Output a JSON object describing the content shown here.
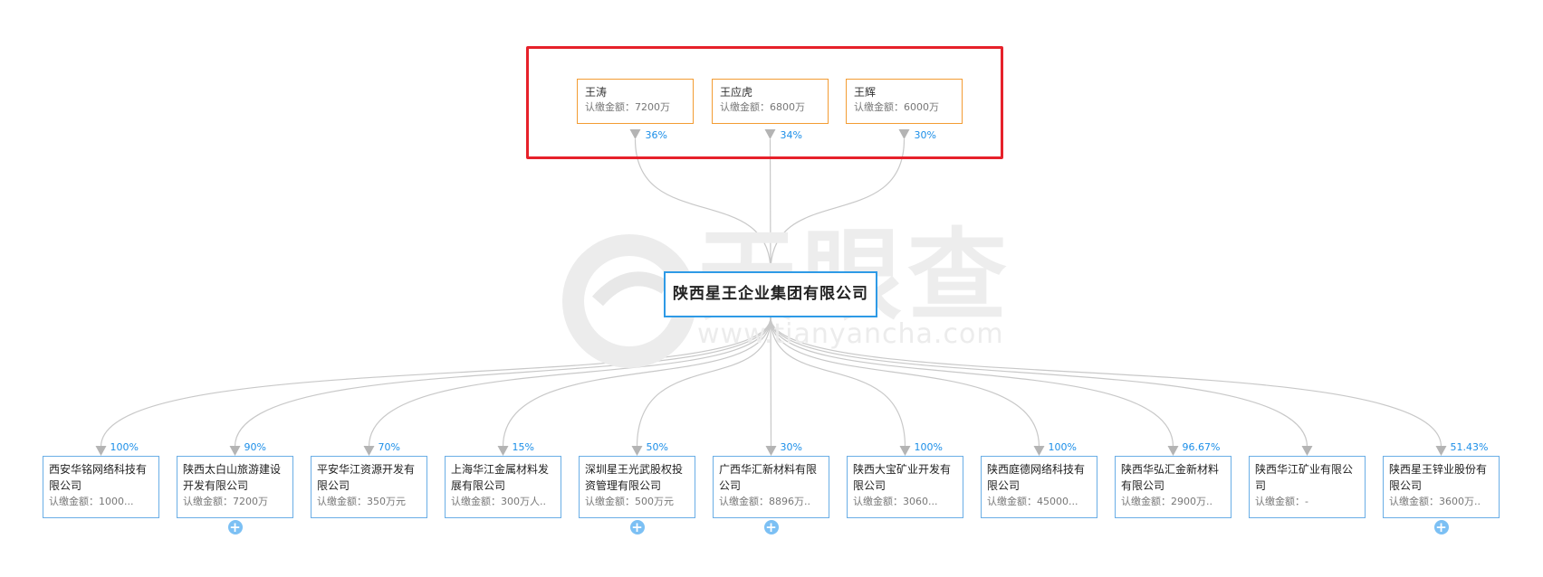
{
  "watermark": {
    "title": "天眼查",
    "url": "www.tianyancha.com"
  },
  "company": {
    "name": "陕西星王企业集团有限公司"
  },
  "shareholders": [
    {
      "name": "王涛",
      "amount": "认缴金额：7200万",
      "percent": "36%"
    },
    {
      "name": "王应虎",
      "amount": "认缴金额：6800万",
      "percent": "34%"
    },
    {
      "name": "王辉",
      "amount": "认缴金额：6000万",
      "percent": "30%"
    }
  ],
  "investments": [
    {
      "name": "西安华铭网络科技有限公司",
      "amount": "认缴金额：1000...",
      "percent": "100%",
      "expandable": false
    },
    {
      "name": "陕西太白山旅游建设开发有限公司",
      "amount": "认缴金额：7200万",
      "percent": "90%",
      "expandable": true
    },
    {
      "name": "平安华江资源开发有限公司",
      "amount": "认缴金额：350万元",
      "percent": "70%",
      "expandable": false
    },
    {
      "name": "上海华江金属材料发展有限公司",
      "amount": "认缴金额：300万人..",
      "percent": "15%",
      "expandable": false
    },
    {
      "name": "深圳星王光武股权投资管理有限公司",
      "amount": "认缴金额：500万元",
      "percent": "50%",
      "expandable": true
    },
    {
      "name": "广西华汇新材料有限公司",
      "amount": "认缴金额：8896万..",
      "percent": "30%",
      "expandable": true
    },
    {
      "name": "陕西大宝矿业开发有限公司",
      "amount": "认缴金额：3060...",
      "percent": "100%",
      "expandable": false
    },
    {
      "name": "陕西庭德网络科技有限公司",
      "amount": "认缴金额：45000...",
      "percent": "100%",
      "expandable": false
    },
    {
      "name": "陕西华弘汇金新材料有限公司",
      "amount": "认缴金额：2900万..",
      "percent": "96.67%",
      "expandable": false
    },
    {
      "name": "陕西华江矿业有限公司",
      "amount": "认缴金额：-",
      "percent": "",
      "expandable": false
    },
    {
      "name": "陕西星王锌业股份有限公司",
      "amount": "认缴金额：3600万..",
      "percent": "51.43%",
      "expandable": true
    }
  ],
  "colors": {
    "shareholder_border": "#f39c33",
    "company_border": "#2e9ae6",
    "investment_border": "#6aaee6",
    "highlight_frame": "#e6212a",
    "percent_text": "#1b8ee8",
    "edge": "#c8c8c8"
  },
  "icons": {
    "expand": "plus-circle-icon",
    "edge_arrow": "arrow-down-icon"
  }
}
